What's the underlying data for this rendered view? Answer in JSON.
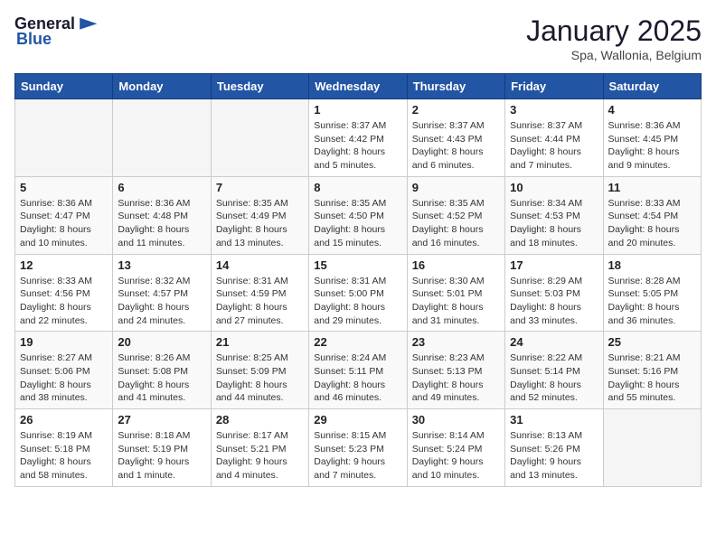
{
  "header": {
    "logo": {
      "general": "General",
      "blue": "Blue"
    },
    "title": "January 2025",
    "subtitle": "Spa, Wallonia, Belgium"
  },
  "days_of_week": [
    "Sunday",
    "Monday",
    "Tuesday",
    "Wednesday",
    "Thursday",
    "Friday",
    "Saturday"
  ],
  "weeks": [
    [
      {
        "day": "",
        "info": ""
      },
      {
        "day": "",
        "info": ""
      },
      {
        "day": "",
        "info": ""
      },
      {
        "day": "1",
        "info": "Sunrise: 8:37 AM\nSunset: 4:42 PM\nDaylight: 8 hours\nand 5 minutes."
      },
      {
        "day": "2",
        "info": "Sunrise: 8:37 AM\nSunset: 4:43 PM\nDaylight: 8 hours\nand 6 minutes."
      },
      {
        "day": "3",
        "info": "Sunrise: 8:37 AM\nSunset: 4:44 PM\nDaylight: 8 hours\nand 7 minutes."
      },
      {
        "day": "4",
        "info": "Sunrise: 8:36 AM\nSunset: 4:45 PM\nDaylight: 8 hours\nand 9 minutes."
      }
    ],
    [
      {
        "day": "5",
        "info": "Sunrise: 8:36 AM\nSunset: 4:47 PM\nDaylight: 8 hours\nand 10 minutes."
      },
      {
        "day": "6",
        "info": "Sunrise: 8:36 AM\nSunset: 4:48 PM\nDaylight: 8 hours\nand 11 minutes."
      },
      {
        "day": "7",
        "info": "Sunrise: 8:35 AM\nSunset: 4:49 PM\nDaylight: 8 hours\nand 13 minutes."
      },
      {
        "day": "8",
        "info": "Sunrise: 8:35 AM\nSunset: 4:50 PM\nDaylight: 8 hours\nand 15 minutes."
      },
      {
        "day": "9",
        "info": "Sunrise: 8:35 AM\nSunset: 4:52 PM\nDaylight: 8 hours\nand 16 minutes."
      },
      {
        "day": "10",
        "info": "Sunrise: 8:34 AM\nSunset: 4:53 PM\nDaylight: 8 hours\nand 18 minutes."
      },
      {
        "day": "11",
        "info": "Sunrise: 8:33 AM\nSunset: 4:54 PM\nDaylight: 8 hours\nand 20 minutes."
      }
    ],
    [
      {
        "day": "12",
        "info": "Sunrise: 8:33 AM\nSunset: 4:56 PM\nDaylight: 8 hours\nand 22 minutes."
      },
      {
        "day": "13",
        "info": "Sunrise: 8:32 AM\nSunset: 4:57 PM\nDaylight: 8 hours\nand 24 minutes."
      },
      {
        "day": "14",
        "info": "Sunrise: 8:31 AM\nSunset: 4:59 PM\nDaylight: 8 hours\nand 27 minutes."
      },
      {
        "day": "15",
        "info": "Sunrise: 8:31 AM\nSunset: 5:00 PM\nDaylight: 8 hours\nand 29 minutes."
      },
      {
        "day": "16",
        "info": "Sunrise: 8:30 AM\nSunset: 5:01 PM\nDaylight: 8 hours\nand 31 minutes."
      },
      {
        "day": "17",
        "info": "Sunrise: 8:29 AM\nSunset: 5:03 PM\nDaylight: 8 hours\nand 33 minutes."
      },
      {
        "day": "18",
        "info": "Sunrise: 8:28 AM\nSunset: 5:05 PM\nDaylight: 8 hours\nand 36 minutes."
      }
    ],
    [
      {
        "day": "19",
        "info": "Sunrise: 8:27 AM\nSunset: 5:06 PM\nDaylight: 8 hours\nand 38 minutes."
      },
      {
        "day": "20",
        "info": "Sunrise: 8:26 AM\nSunset: 5:08 PM\nDaylight: 8 hours\nand 41 minutes."
      },
      {
        "day": "21",
        "info": "Sunrise: 8:25 AM\nSunset: 5:09 PM\nDaylight: 8 hours\nand 44 minutes."
      },
      {
        "day": "22",
        "info": "Sunrise: 8:24 AM\nSunset: 5:11 PM\nDaylight: 8 hours\nand 46 minutes."
      },
      {
        "day": "23",
        "info": "Sunrise: 8:23 AM\nSunset: 5:13 PM\nDaylight: 8 hours\nand 49 minutes."
      },
      {
        "day": "24",
        "info": "Sunrise: 8:22 AM\nSunset: 5:14 PM\nDaylight: 8 hours\nand 52 minutes."
      },
      {
        "day": "25",
        "info": "Sunrise: 8:21 AM\nSunset: 5:16 PM\nDaylight: 8 hours\nand 55 minutes."
      }
    ],
    [
      {
        "day": "26",
        "info": "Sunrise: 8:19 AM\nSunset: 5:18 PM\nDaylight: 8 hours\nand 58 minutes."
      },
      {
        "day": "27",
        "info": "Sunrise: 8:18 AM\nSunset: 5:19 PM\nDaylight: 9 hours\nand 1 minute."
      },
      {
        "day": "28",
        "info": "Sunrise: 8:17 AM\nSunset: 5:21 PM\nDaylight: 9 hours\nand 4 minutes."
      },
      {
        "day": "29",
        "info": "Sunrise: 8:15 AM\nSunset: 5:23 PM\nDaylight: 9 hours\nand 7 minutes."
      },
      {
        "day": "30",
        "info": "Sunrise: 8:14 AM\nSunset: 5:24 PM\nDaylight: 9 hours\nand 10 minutes."
      },
      {
        "day": "31",
        "info": "Sunrise: 8:13 AM\nSunset: 5:26 PM\nDaylight: 9 hours\nand 13 minutes."
      },
      {
        "day": "",
        "info": ""
      }
    ]
  ]
}
